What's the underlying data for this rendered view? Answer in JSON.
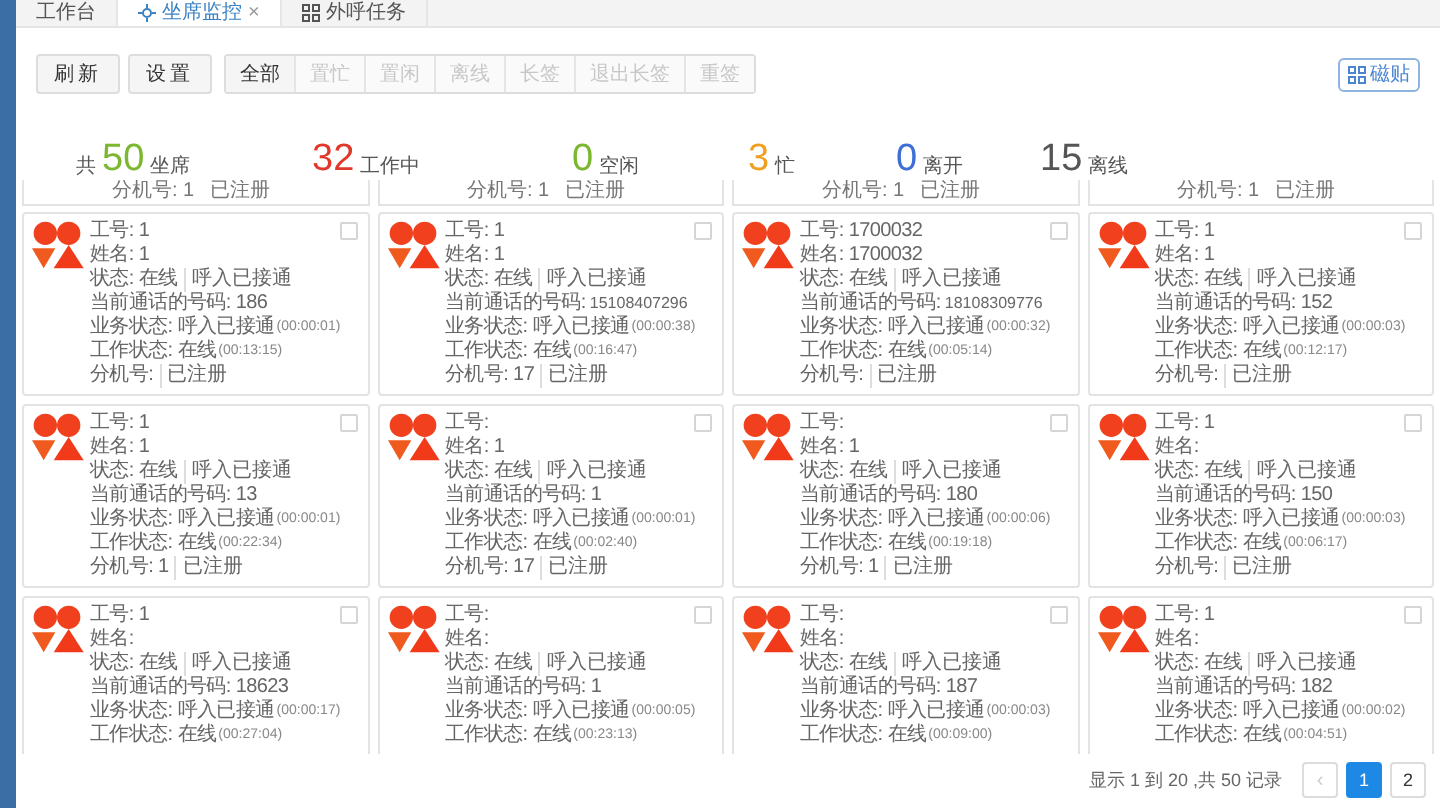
{
  "tabs": [
    {
      "label": "工作台",
      "kind": "plain",
      "selected": false
    },
    {
      "label": "坐席监控",
      "kind": "monitor",
      "selected": true,
      "close": "×"
    },
    {
      "label": "外呼任务",
      "kind": "grid",
      "selected": false
    }
  ],
  "toolbar": {
    "buttons": [
      "刷新",
      "设置"
    ],
    "filters": [
      {
        "label": "全部",
        "disabled": false
      },
      {
        "label": "置忙",
        "disabled": true
      },
      {
        "label": "置闲",
        "disabled": true
      },
      {
        "label": "离线",
        "disabled": true
      },
      {
        "label": "长签",
        "disabled": true
      },
      {
        "label": "退出长签",
        "disabled": true
      },
      {
        "label": "重签",
        "disabled": true
      }
    ],
    "tile_button": "磁贴"
  },
  "stats": [
    {
      "prefix": "共",
      "value": "50",
      "label": "坐席",
      "color": "#7cb82f"
    },
    {
      "value": "32",
      "label": "工作中",
      "color": "#e0392b"
    },
    {
      "value": "0",
      "label": "空闲",
      "color": "#7cb82f"
    },
    {
      "value": "3",
      "label": "忙",
      "color": "#f0a020"
    },
    {
      "value": "0",
      "label": "离开",
      "color": "#3d6fd6"
    },
    {
      "value": "15",
      "label": "离线",
      "color": "#555555"
    }
  ],
  "partial_cards": [
    {
      "text": "分机号: 1",
      "extra": "已注册"
    },
    {
      "text": "分机号: 1",
      "extra": "已注册"
    },
    {
      "text": "分机号: 1",
      "extra": "已注册"
    },
    {
      "text": "分机号: 1",
      "extra": "已注册"
    }
  ],
  "cards": [
    {
      "checked": false,
      "lines": [
        {
          "text": "工号: 1"
        },
        {
          "text": "姓名: 1"
        },
        {
          "text": "状态: 在线",
          "extra": "呼入已接通"
        },
        {
          "text": "当前通话的号码: 186"
        },
        {
          "text": "业务状态: 呼入已接通",
          "time": "(00:00:01)"
        },
        {
          "text": "工作状态: 在线",
          "time": "(00:13:15)"
        },
        {
          "text": "分机号:",
          "extra": "已注册"
        }
      ]
    },
    {
      "checked": false,
      "lines": [
        {
          "text": "工号: 1"
        },
        {
          "text": "姓名: 1"
        },
        {
          "text": "状态: 在线",
          "extra": "呼入已接通"
        },
        {
          "text": "当前通话的号码:",
          "number": "15108407296"
        },
        {
          "text": "业务状态: 呼入已接通",
          "time": "(00:00:38)"
        },
        {
          "text": "工作状态: 在线",
          "time": "(00:16:47)"
        },
        {
          "text": "分机号: 17",
          "extra": "已注册"
        }
      ]
    },
    {
      "checked": false,
      "lines": [
        {
          "text": "工号: 1700032"
        },
        {
          "text": "姓名: 1700032"
        },
        {
          "text": "状态: 在线",
          "extra": "呼入已接通"
        },
        {
          "text": "当前通话的号码:",
          "number": "18108309776"
        },
        {
          "text": "业务状态: 呼入已接通",
          "time": "(00:00:32)"
        },
        {
          "text": "工作状态: 在线",
          "time": "(00:05:14)"
        },
        {
          "text": "分机号:",
          "extra": "已注册"
        }
      ]
    },
    {
      "checked": false,
      "lines": [
        {
          "text": "工号: 1"
        },
        {
          "text": "姓名: 1"
        },
        {
          "text": "状态: 在线",
          "extra": "呼入已接通"
        },
        {
          "text": "当前通话的号码: 152"
        },
        {
          "text": "业务状态: 呼入已接通",
          "time": "(00:00:03)"
        },
        {
          "text": "工作状态: 在线",
          "time": "(00:12:17)"
        },
        {
          "text": "分机号:",
          "extra": "已注册"
        }
      ]
    },
    {
      "checked": false,
      "lines": [
        {
          "text": "工号: 1"
        },
        {
          "text": "姓名: 1"
        },
        {
          "text": "状态: 在线",
          "extra": "呼入已接通"
        },
        {
          "text": "当前通话的号码: 13"
        },
        {
          "text": "业务状态: 呼入已接通",
          "time": "(00:00:01)"
        },
        {
          "text": "工作状态: 在线",
          "time": "(00:22:34)"
        },
        {
          "text": "分机号: 1",
          "extra": "已注册"
        }
      ]
    },
    {
      "checked": false,
      "lines": [
        {
          "text": "工号:"
        },
        {
          "text": "姓名: 1"
        },
        {
          "text": "状态: 在线",
          "extra": "呼入已接通"
        },
        {
          "text": "当前通话的号码: 1"
        },
        {
          "text": "业务状态: 呼入已接通",
          "time": "(00:00:01)"
        },
        {
          "text": "工作状态: 在线",
          "time": "(00:02:40)"
        },
        {
          "text": "分机号: 17",
          "extra": "已注册"
        }
      ]
    },
    {
      "checked": false,
      "lines": [
        {
          "text": "工号:"
        },
        {
          "text": "姓名: 1"
        },
        {
          "text": "状态: 在线",
          "extra": "呼入已接通"
        },
        {
          "text": "当前通话的号码: 180"
        },
        {
          "text": "业务状态: 呼入已接通",
          "time": "(00:00:06)"
        },
        {
          "text": "工作状态: 在线",
          "time": "(00:19:18)"
        },
        {
          "text": "分机号: 1",
          "extra": "已注册"
        }
      ]
    },
    {
      "checked": false,
      "lines": [
        {
          "text": "工号: 1"
        },
        {
          "text": "姓名:"
        },
        {
          "text": "状态: 在线",
          "extra": "呼入已接通"
        },
        {
          "text": "当前通话的号码: 150"
        },
        {
          "text": "业务状态: 呼入已接通",
          "time": "(00:00:03)"
        },
        {
          "text": "工作状态: 在线",
          "time": "(00:06:17)"
        },
        {
          "text": "分机号:",
          "extra": "已注册"
        }
      ]
    },
    {
      "checked": false,
      "lines": [
        {
          "text": "工号: 1"
        },
        {
          "text": "姓名:"
        },
        {
          "text": "状态: 在线",
          "extra": "呼入已接通"
        },
        {
          "text": "当前通话的号码: 18623"
        },
        {
          "text": "业务状态: 呼入已接通",
          "time": "(00:00:17)"
        },
        {
          "text": "工作状态: 在线",
          "time": "(00:27:04)"
        }
      ]
    },
    {
      "checked": false,
      "lines": [
        {
          "text": "工号:"
        },
        {
          "text": "姓名:"
        },
        {
          "text": "状态: 在线",
          "extra": "呼入已接通"
        },
        {
          "text": "当前通话的号码: 1"
        },
        {
          "text": "业务状态: 呼入已接通",
          "time": "(00:00:05)"
        },
        {
          "text": "工作状态: 在线",
          "time": "(00:23:13)"
        }
      ]
    },
    {
      "checked": false,
      "lines": [
        {
          "text": "工号:"
        },
        {
          "text": "姓名:"
        },
        {
          "text": "状态: 在线",
          "extra": "呼入已接通"
        },
        {
          "text": "当前通话的号码: 187"
        },
        {
          "text": "业务状态: 呼入已接通",
          "time": "(00:00:03)"
        },
        {
          "text": "工作状态: 在线",
          "time": "(00:09:00)"
        }
      ]
    },
    {
      "checked": false,
      "lines": [
        {
          "text": "工号: 1"
        },
        {
          "text": "姓名:"
        },
        {
          "text": "状态: 在线",
          "extra": "呼入已接通"
        },
        {
          "text": "当前通话的号码: 182"
        },
        {
          "text": "业务状态: 呼入已接通",
          "time": "(00:00:02)"
        },
        {
          "text": "工作状态: 在线",
          "time": "(00:04:51)"
        }
      ]
    }
  ],
  "pagination": {
    "summary": "显示 1 到 20 ,共 50 记录",
    "prev": "‹",
    "prev_disabled": true,
    "pages": [
      {
        "label": "1",
        "selected": true
      },
      {
        "label": "2",
        "selected": false
      }
    ]
  }
}
